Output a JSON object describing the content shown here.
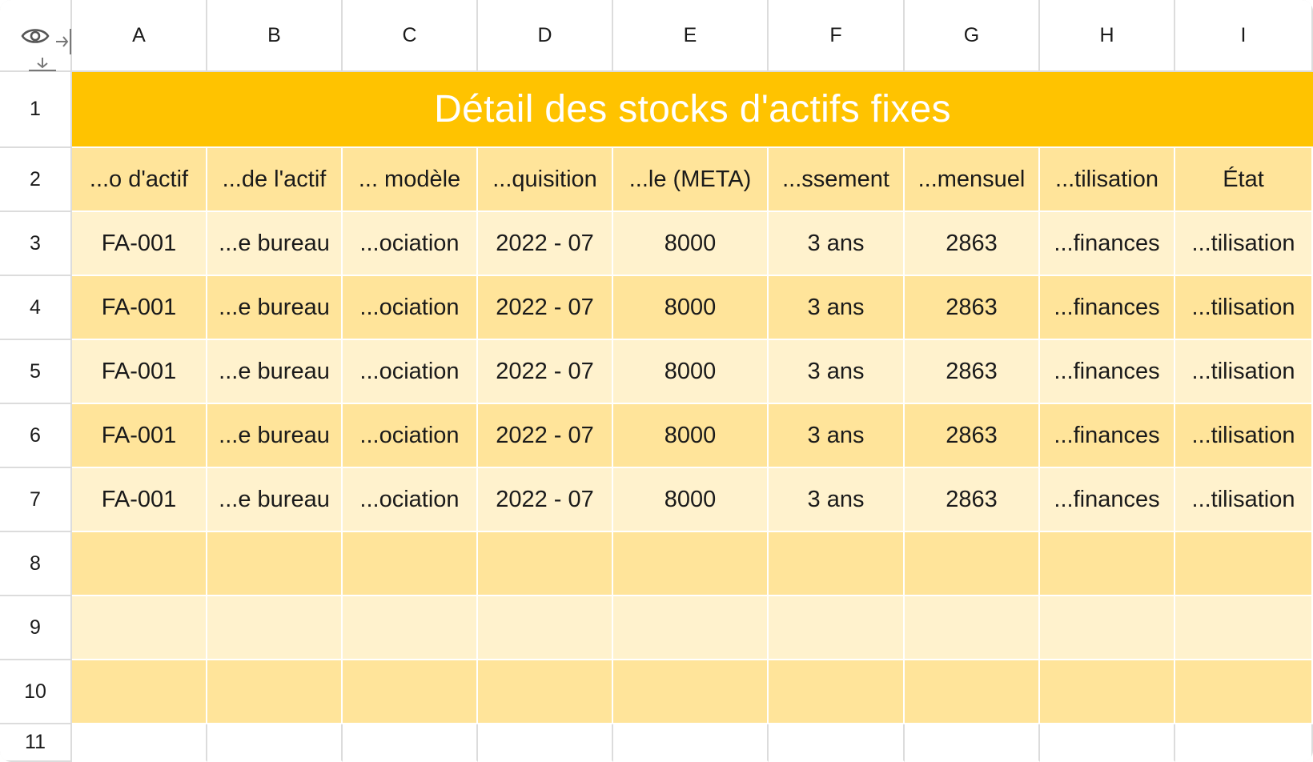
{
  "columns": [
    "A",
    "B",
    "C",
    "D",
    "E",
    "F",
    "G",
    "H",
    "I"
  ],
  "rows": [
    "1",
    "2",
    "3",
    "4",
    "5",
    "6",
    "7",
    "8",
    "9",
    "10",
    "11"
  ],
  "title": "Détail des stocks d'actifs fixes",
  "headers": [
    "...o d'actif",
    "...de l'actif",
    "... modèle",
    "...quisition",
    "...le (META)",
    "...ssement",
    "...mensuel",
    "...tilisation",
    "État"
  ],
  "data_rows": [
    [
      "FA-001",
      "...e bureau",
      "...ociation",
      "2022 - 07",
      "8000",
      "3 ans",
      "2863",
      "...finances",
      "...tilisation"
    ],
    [
      "FA-001",
      "...e bureau",
      "...ociation",
      "2022 - 07",
      "8000",
      "3 ans",
      "2863",
      "...finances",
      "...tilisation"
    ],
    [
      "FA-001",
      "...e bureau",
      "...ociation",
      "2022 - 07",
      "8000",
      "3 ans",
      "2863",
      "...finances",
      "...tilisation"
    ],
    [
      "FA-001",
      "...e bureau",
      "...ociation",
      "2022 - 07",
      "8000",
      "3 ans",
      "2863",
      "...finances",
      "...tilisation"
    ],
    [
      "FA-001",
      "...e bureau",
      "...ociation",
      "2022 - 07",
      "8000",
      "3 ans",
      "2863",
      "...finances",
      "...tilisation"
    ]
  ],
  "icons": {
    "visibility": "eye-icon",
    "column_resize": "column-resize-icon",
    "row_resize": "row-resize-icon"
  },
  "colors": {
    "title_bg": "#ffc300",
    "header_bg": "#ffe49a",
    "row_light": "#fff2cd",
    "row_dark": "#ffe49a",
    "grid_line": "#dcdcdc"
  }
}
